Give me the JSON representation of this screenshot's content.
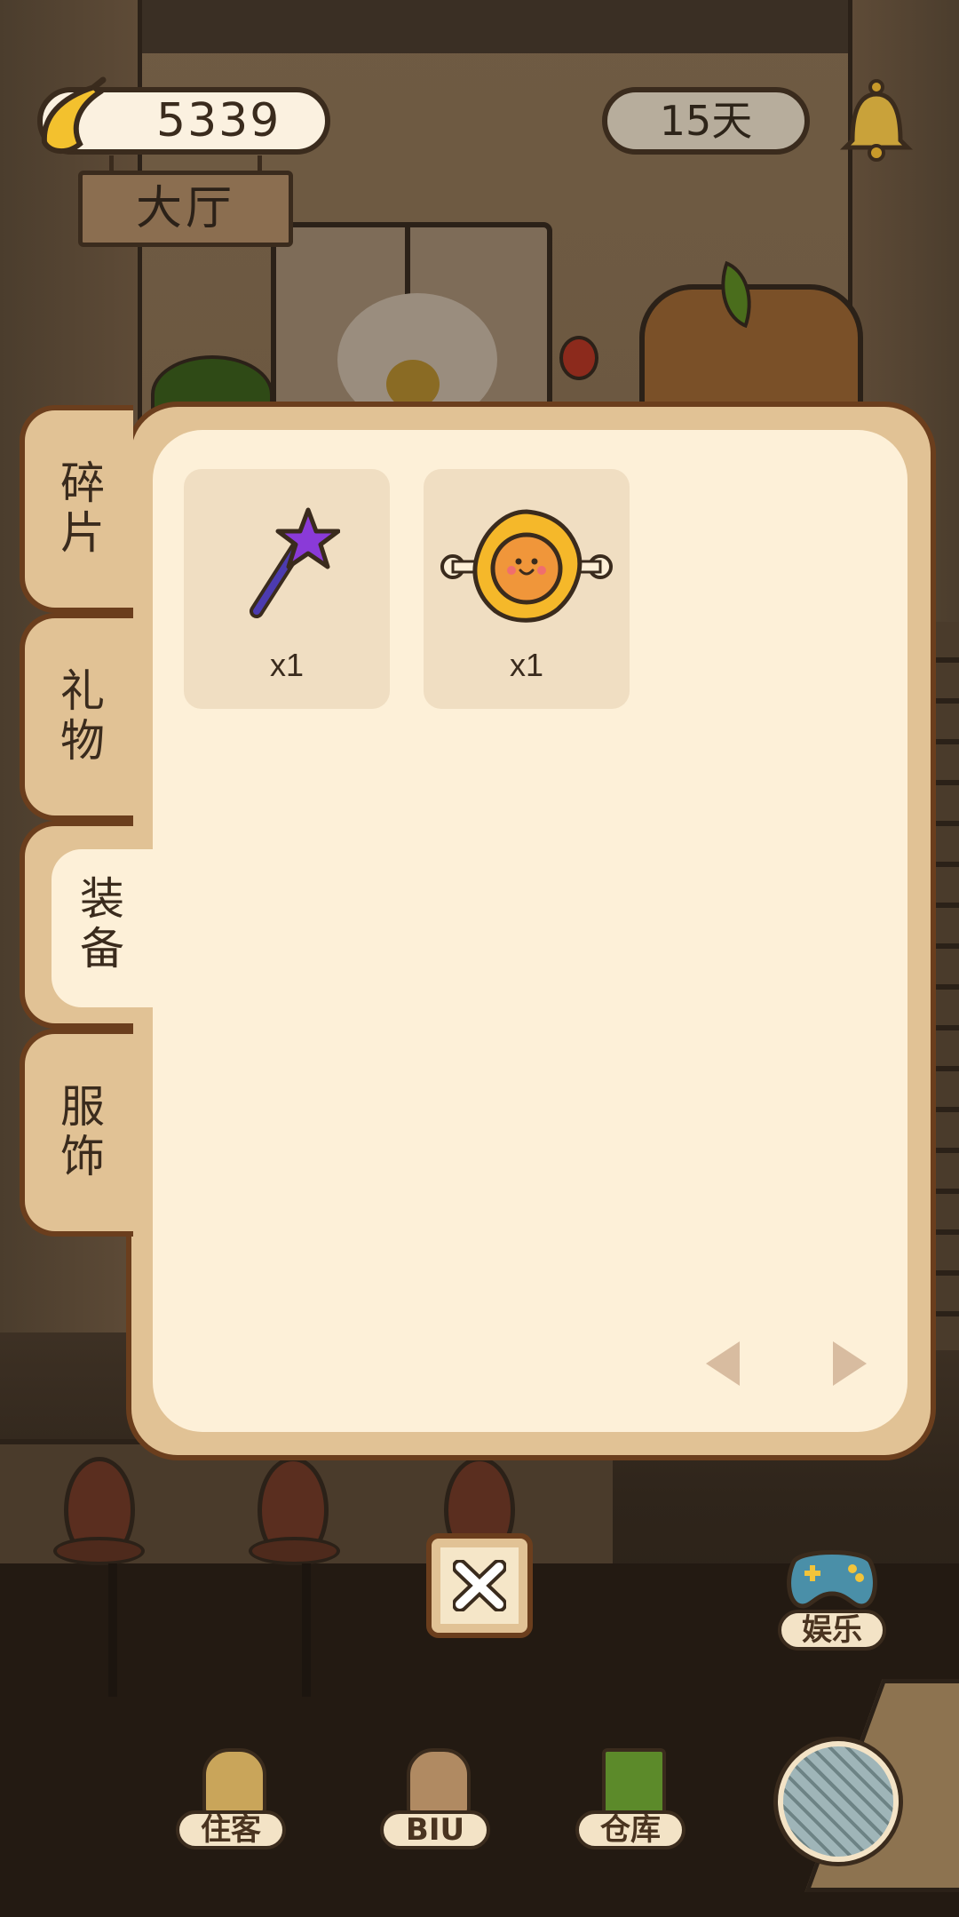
{
  "hud": {
    "bananas": "5339",
    "days": "15天",
    "room": "大厅"
  },
  "tabs": [
    {
      "label": "碎片",
      "active": false
    },
    {
      "label": "礼物",
      "active": false
    },
    {
      "label": "装备",
      "active": true
    },
    {
      "label": "服饰",
      "active": false
    }
  ],
  "items": [
    {
      "icon": "purple-star-wand-icon",
      "quantity": "x1"
    },
    {
      "icon": "sun-face-icon",
      "quantity": "x1"
    }
  ],
  "bottom_nav": [
    {
      "label": "住客",
      "icon": "guest-icon"
    },
    {
      "label": "BIU",
      "icon": "cat-icon"
    },
    {
      "label": "仓库",
      "icon": "warehouse-icon"
    }
  ],
  "entertainment": {
    "label": "娱乐",
    "icon": "gamepad-icon"
  },
  "colors": {
    "panel_border": "#6b3e1d",
    "panel_frame": "#e1c295",
    "panel_bg": "#fdf0d8",
    "slot_bg": "#f0dec2",
    "wand_star": "#8a3ad8",
    "sun": "#f5b82a"
  }
}
